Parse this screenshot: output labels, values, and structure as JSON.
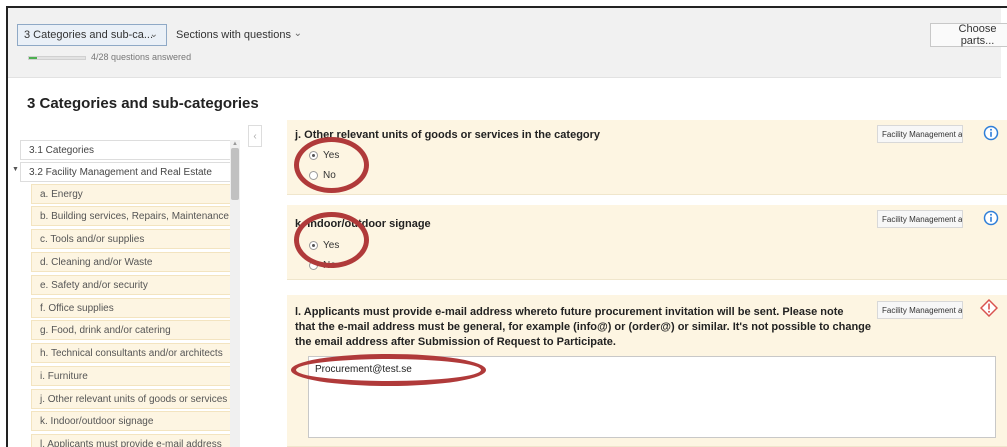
{
  "toolbar": {
    "category_select": "3 Categories and sub-ca...",
    "view_select": "Sections with questions",
    "progress_text": "4/28 questions answered",
    "progress_fraction": 0.14,
    "choose_parts": "Choose parts..."
  },
  "page_title": "3 Categories and sub-categories",
  "tree": {
    "cat1": "3.1 Categories",
    "cat2": "3.2 Facility Management and Real Estate",
    "subs": [
      "a. Energy",
      "b. Building services, Repairs, Maintenance",
      "c. Tools and/or supplies",
      "d. Cleaning and/or Waste",
      "e. Safety and/or security",
      "f. Office supplies",
      "g. Food, drink and/or catering",
      "h. Technical consultants and/or architects",
      "i. Furniture",
      "j. Other relevant units of goods or services",
      "k. Indoor/outdoor signage",
      "l. Applicants must provide e-mail address"
    ]
  },
  "questions": {
    "j": {
      "title": "j. Other relevant units of goods or services in the category",
      "badge": "Facility Management a...",
      "yes": "Yes",
      "no": "No"
    },
    "k": {
      "title": "k. Indoor/outdoor signage",
      "badge": "Facility Management a...",
      "yes": "Yes",
      "no": "No"
    },
    "l": {
      "title_line1": "l. Applicants must provide e-mail address whereto future procurement invitation will be sent. Please note",
      "title_line2": "that the e-mail address must be general, for example (info@) or (order@) or similar. It's not possible to change",
      "title_line3": "the email address after Submission of Request to Participate.",
      "badge": "Facility Management a...",
      "answer": "Procurement@test.se"
    }
  },
  "colors": {
    "card_bg": "#fdf5e2",
    "annotation": "#b03a3a",
    "info": "#2f7fd8",
    "warning": "#d9534f"
  },
  "icons": {
    "info": "info-circle-icon",
    "warning": "warning-diamond-icon",
    "chevron": "chevron-down-icon",
    "collapse": "chevron-left-icon"
  }
}
